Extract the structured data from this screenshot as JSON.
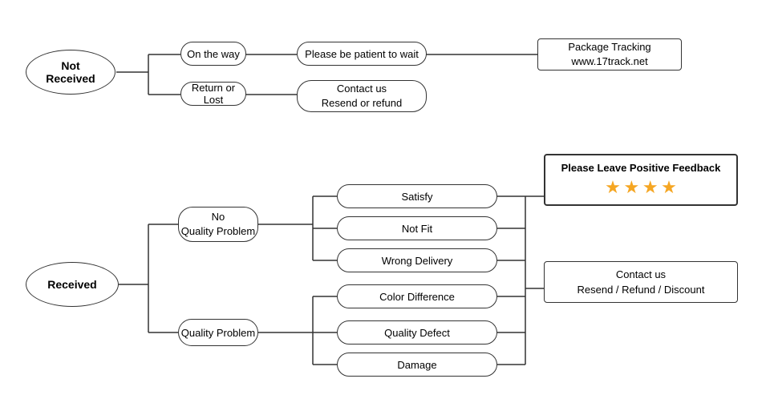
{
  "nodes": {
    "not_received": {
      "label": "Not\nReceived"
    },
    "on_the_way": {
      "label": "On the way"
    },
    "patient_wait": {
      "label": "Please be patient to wait"
    },
    "package_tracking": {
      "label": "Package Tracking\nwww.17track.net"
    },
    "return_or_lost": {
      "label": "Return or Lost"
    },
    "contact_us_resend": {
      "label": "Contact us\nResend or refund"
    },
    "received": {
      "label": "Received"
    },
    "no_quality_problem": {
      "label": "No\nQuality Problem"
    },
    "satisfy": {
      "label": "Satisfy"
    },
    "not_fit": {
      "label": "Not Fit"
    },
    "wrong_delivery": {
      "label": "Wrong Delivery"
    },
    "quality_problem": {
      "label": "Quality Problem"
    },
    "color_difference": {
      "label": "Color Difference"
    },
    "quality_defect": {
      "label": "Quality Defect"
    },
    "damage": {
      "label": "Damage"
    },
    "please_leave": {
      "label": "Please Leave Positive Feedback"
    },
    "stars": {
      "count": 4,
      "char": "★"
    },
    "contact_us_refund": {
      "label": "Contact us\nResend / Refund / Discount"
    }
  }
}
